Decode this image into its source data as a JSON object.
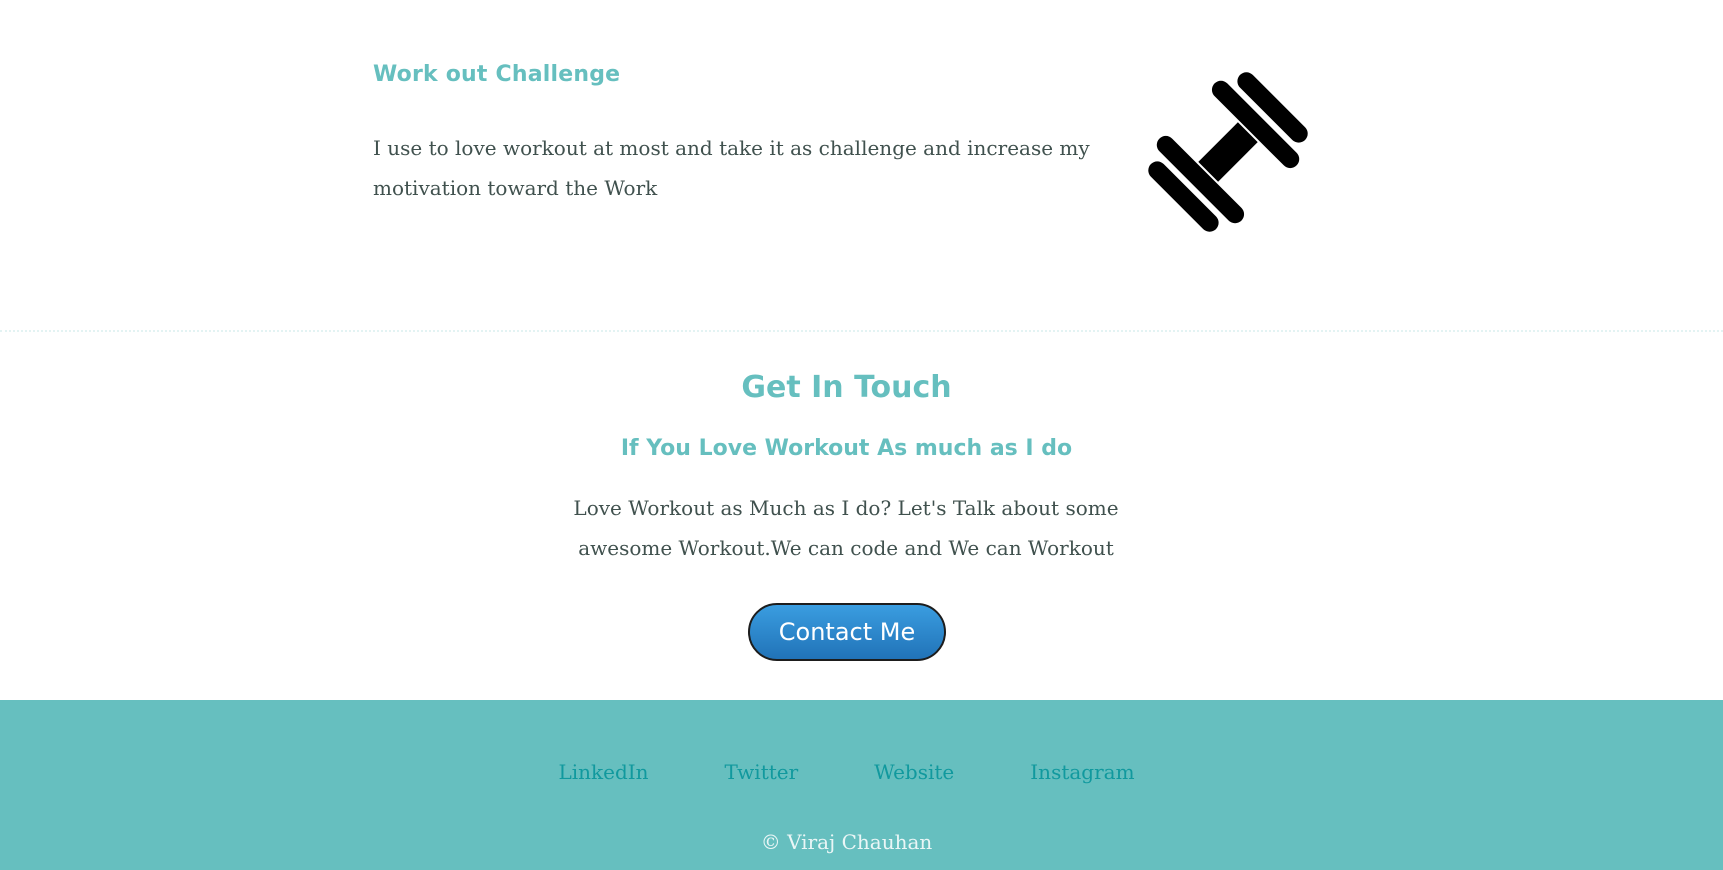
{
  "workout": {
    "title": "Work out Challenge",
    "text": "I use to love workout at most and take it as challenge and increase my motivation toward the Work",
    "image_icon": "dumbbell-icon"
  },
  "contact": {
    "title": "Get In Touch",
    "subtitle": "If You Love Workout As much as I do",
    "text": "Love Workout as Much as I do? Let's Talk about some awesome Workout.We can code and We can Workout",
    "button_label": "Contact Me"
  },
  "footer": {
    "links": [
      "LinkedIn",
      "Twitter",
      "Website",
      "Instagram"
    ],
    "copyright": "© Viraj Chauhan"
  },
  "colors": {
    "accent": "#66bfbf",
    "text": "#40514e",
    "footer_link": "#11999e",
    "button": "#2b86cf",
    "footer_bg": "#66bfbf",
    "footer_text": "#eaf6f6"
  }
}
